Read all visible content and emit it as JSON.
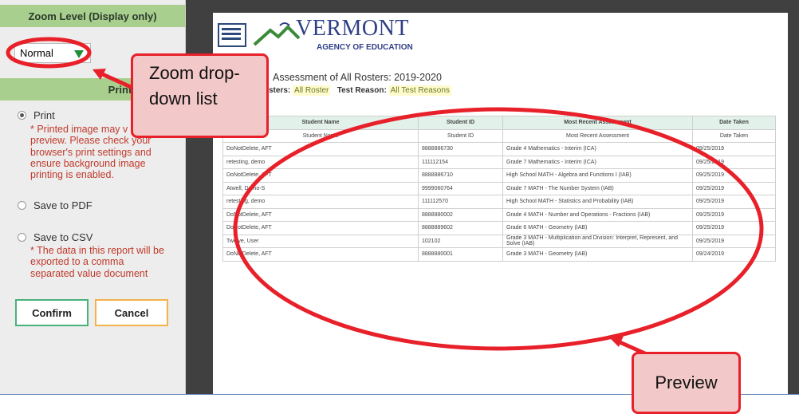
{
  "sidebar": {
    "zoom_header": "Zoom Level (Display only)",
    "zoom_value": "Normal",
    "print_header": "Print Options",
    "options": [
      {
        "label": "Print",
        "checked": true
      },
      {
        "label": "Save to PDF",
        "checked": false
      },
      {
        "label": "Save to CSV",
        "checked": false
      }
    ],
    "print_note": [
      "* Printed image may v",
      "preview. Please check your",
      "browser's print settings and",
      "ensure background image",
      "printing is enabled."
    ],
    "csv_note": [
      "* The data in this report will be",
      "exported to a comma",
      "separated value document"
    ],
    "confirm_label": "Confirm",
    "cancel_label": "Cancel"
  },
  "report": {
    "org_title": "VERMONT",
    "org_subtitle": "AGENCY OF EDUCATION",
    "title": "Assessment of All Rosters: 2019-2020",
    "filter_label_1": "sters:",
    "filter_value_1": "All Roster",
    "filter_label_2": "Test Reason:",
    "filter_value_2": "All Test Reasons",
    "columns": [
      "Student Name",
      "Student ID",
      "Most Recent Assessment",
      "Date Taken"
    ],
    "rows": [
      [
        "DoNotDelete, AFT",
        "8888886730",
        "Grade 4 Mathematics - Interim (ICA)",
        "09/25/2019"
      ],
      [
        "retesting, demo",
        "111112154",
        "Grade 7 Mathematics - Interim (ICA)",
        "09/25/2019"
      ],
      [
        "DoNotDelete, AFT",
        "8888886710",
        "High School MATH - Algebra and Functions I (IAB)",
        "09/25/2019"
      ],
      [
        "Atwell, Demo-S",
        "9999060764",
        "Grade 7 MATH - The Number System (IAB)",
        "09/25/2019"
      ],
      [
        "retesting, demo",
        "111112570",
        "High School MATH - Statistics and Probability (IAB)",
        "09/25/2019"
      ],
      [
        "DoNotDelete, AFT",
        "8888880002",
        "Grade 4 MATH - Number and Operations - Fractions (IAB)",
        "09/25/2019"
      ],
      [
        "DoNotDelete, AFT",
        "8888889602",
        "Grade 6 MATH - Geometry (IAB)",
        "09/25/2019"
      ],
      [
        "Twelve, User",
        "102102",
        "Grade 3 MATH - Multiplication and Division: Interpret, Represent, and Solve (IAB)",
        "09/25/2019"
      ],
      [
        "DoNotDelete, AFT",
        "8888880001",
        "Grade 3 MATH - Geometry (IAB)",
        "09/24/2019"
      ]
    ]
  },
  "annotations": {
    "zoom_callout": [
      "Zoom drop-",
      "down list"
    ],
    "preview_callout": "Preview",
    "highlight_color": "#e8202a"
  }
}
